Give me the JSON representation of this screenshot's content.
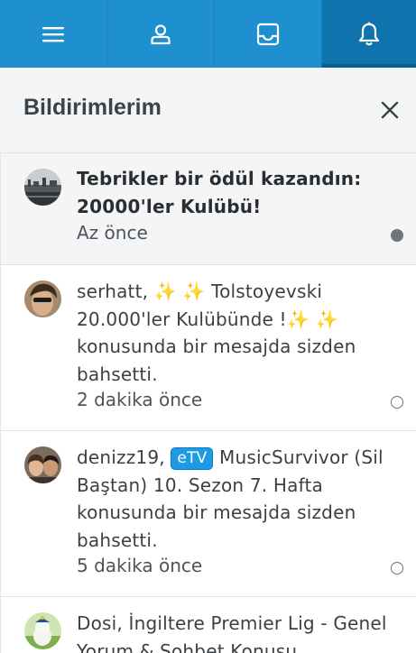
{
  "topbar": {
    "tabs": [
      {
        "icon": "menu-icon",
        "active": false
      },
      {
        "icon": "user-icon",
        "active": false
      },
      {
        "icon": "inbox-icon",
        "active": false
      },
      {
        "icon": "bell-icon",
        "active": true
      }
    ],
    "colors": {
      "bar": "#1e8fcf",
      "active": "#0f73ae"
    }
  },
  "panel": {
    "title": "Bildirimlerim",
    "close_icon": "close-icon"
  },
  "notifications": [
    {
      "text_line1": "Tebrikler bir ödül kazandın:",
      "text_line2": "20000'ler Kulübü!",
      "time": "Az önce",
      "unread": true
    },
    {
      "user": "serhatt,",
      "sparkles1": "✨ ✨",
      "title_part1": "Tolstoyevski",
      "title_part2": "20.000'ler Kulübünde !",
      "sparkles2": "✨ ✨",
      "line3": "konusunda bir mesajda sizden",
      "line4": "bahsetti.",
      "time": "2 dakika önce",
      "unread": false
    },
    {
      "user": "denizz19,",
      "badge": "eTV",
      "title_part1": "MusicSurvivor (Sil",
      "title_part2": "Baştan) 10. Sezon 7. Hafta",
      "line3": "konusunda bir mesajda sizden",
      "line4": "bahsetti.",
      "time": "5 dakika önce",
      "unread": false
    },
    {
      "title_line1": "Dosi, İngiltere Premier Lig - Genel",
      "title_line2": "Yorum & Sohbet Konusu"
    }
  ]
}
